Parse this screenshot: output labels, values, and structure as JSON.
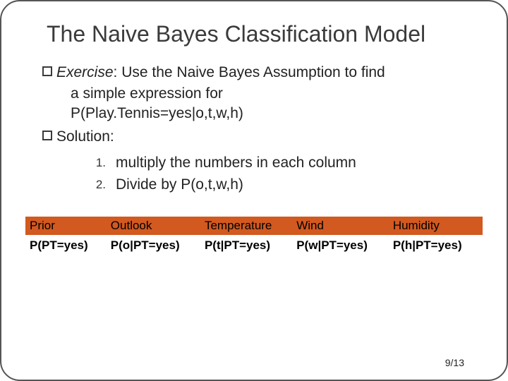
{
  "title": "The Naive Bayes Classification Model",
  "bullets": {
    "exercise_label": "Exercise",
    "exercise_sep": ": ",
    "exercise_text": "Use the Naive Bayes Assumption to find",
    "exercise_cont1": "a simple expression for",
    "exercise_cont2": "P(Play.Tennis=yes|o,t,w,h)",
    "solution_label": "Solution:"
  },
  "enum": {
    "n1": "1.",
    "t1": "multiply the numbers in each column",
    "n2": "2.",
    "t2": "Divide by P(o,t,w,h)"
  },
  "table": {
    "headers": [
      "Prior",
      "Outlook",
      "Temperature",
      "Wind",
      "Humidity"
    ],
    "row": [
      "P(PT=yes)",
      "P(o|PT=yes)",
      "P(t|PT=yes)",
      "P(w|PT=yes)",
      "P(h|PT=yes)"
    ]
  },
  "page": "9/13"
}
